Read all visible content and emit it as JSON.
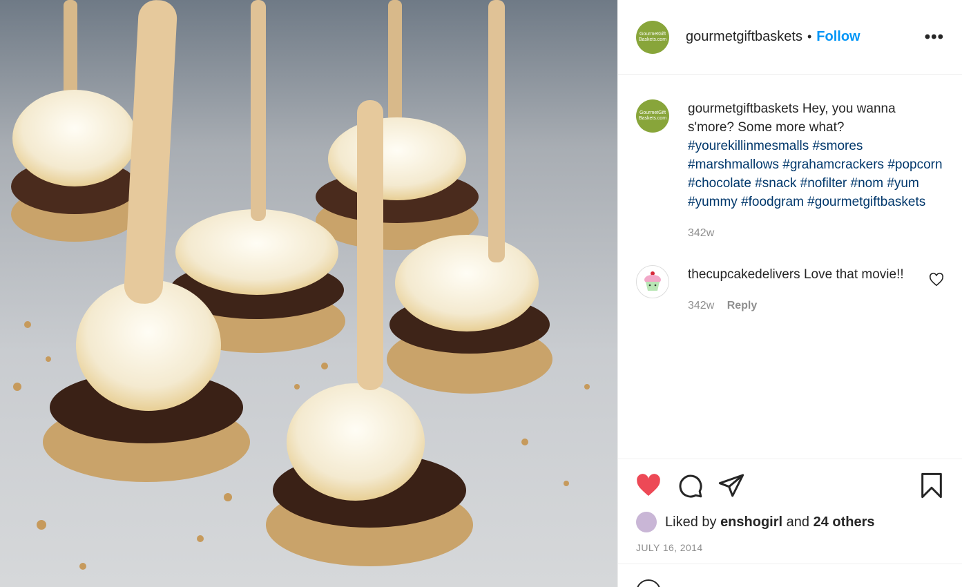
{
  "post": {
    "image_alt": "Chocolate dipped s'mores popcorn pops on wooden sticks",
    "author": {
      "avatar_text_1": "GourmetGift",
      "avatar_text_2": "Baskets.com",
      "username": "gourmetgiftbaskets",
      "separator": "•",
      "follow_label": "Follow",
      "more_label": "•••"
    },
    "caption": {
      "username": "gourmetgiftbaskets",
      "text": "Hey, you wanna s'more? Some more what?",
      "hashtags": "#yourekillinmesmalls #smores #marshmallows #grahamcrackers #popcorn #chocolate #snack #nofilter #nom #yum #yummy #foodgram #gourmetgiftbaskets",
      "time": "342w"
    },
    "comments": [
      {
        "username": "thecupcakedelivers",
        "text": "Love that movie!!",
        "time": "342w",
        "reply_label": "Reply"
      }
    ],
    "likes": {
      "prefix": "Liked by",
      "user": "enshogirl",
      "and": "and",
      "others": "24 others"
    },
    "date": "JULY 16, 2014",
    "colors": {
      "like": "#ed4956",
      "follow": "#0095f6",
      "hashtag": "#00376b",
      "avatar": "#88a53a"
    },
    "icons": [
      "heart-filled-icon",
      "comment-icon",
      "share-icon",
      "bookmark-icon",
      "heart-outline-icon",
      "more-icon"
    ]
  }
}
